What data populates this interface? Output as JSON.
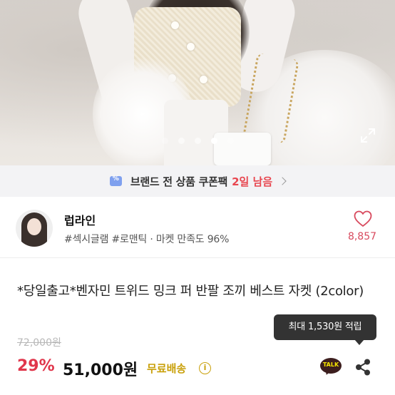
{
  "gallery": {
    "dot_count": 5,
    "active_index": 3
  },
  "coupon_banner": {
    "icon_glyph": "%",
    "text": "브랜드 전 상품 쿠폰팩",
    "highlight": "2일 남음",
    "highlight_color": "#e8464f"
  },
  "store": {
    "name": "럽라인",
    "tags": "#섹시글램 #로맨틱 · 마켓 만족도 96%",
    "likes": "8,857"
  },
  "product": {
    "title": "*당일출고*벤자민 트위드 밍크 퍼 반팔 조끼 베스트 자켓 (2color)",
    "original_price": "72,000원",
    "discount": "29%",
    "price": "51,000원",
    "shipping": "무료배송",
    "info_glyph": "i"
  },
  "tooltip": {
    "text": "최대 1,530원 적립"
  },
  "actions": {
    "talk_label": "TALK"
  },
  "colors": {
    "accent_red": "#e0364b",
    "shipping_gold": "#c9a00a",
    "coupon_blue": "#7fa0ee"
  }
}
